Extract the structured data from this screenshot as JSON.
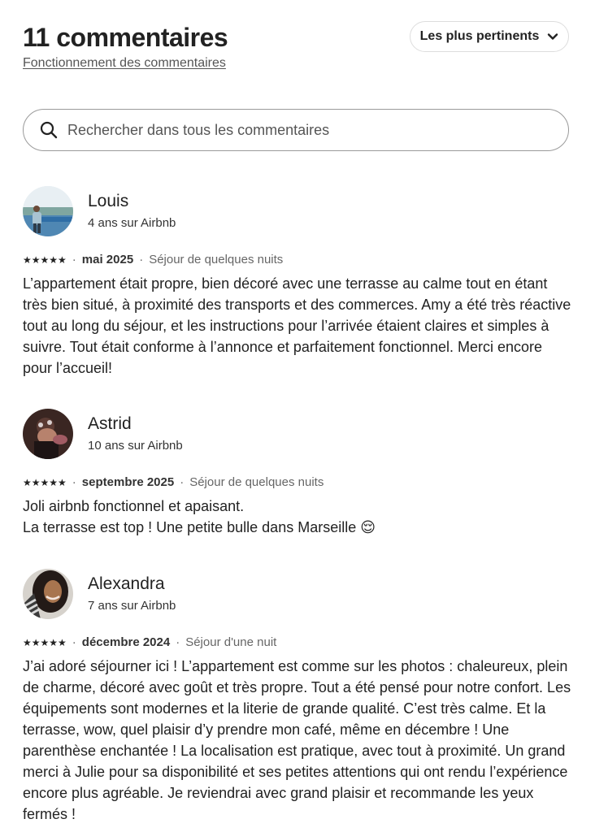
{
  "header": {
    "title": "11 commentaires",
    "how_link": "Fonctionnement des commentaires",
    "sort_label": "Les plus pertinents"
  },
  "search": {
    "placeholder": "Rechercher dans tous les commentaires"
  },
  "reviews": [
    {
      "name": "Louis",
      "tenure": "4 ans sur Airbnb",
      "stars": "★★★★★",
      "rating": 5,
      "date": "mai 2025",
      "stay": "Séjour de quelques nuits",
      "text": "L’appartement était propre, bien décoré avec une terrasse au calme tout en étant très bien situé, à proximité des transports et des commerces. Amy a été très réactive tout au long du séjour, et les instructions pour l’arrivée étaient claires et simples à suivre. Tout était conforme à l’annonce et parfaitement fonctionnel. Merci encore pour l’accueil!"
    },
    {
      "name": "Astrid",
      "tenure": "10 ans sur Airbnb",
      "stars": "★★★★★",
      "rating": 5,
      "date": "septembre 2025",
      "stay": "Séjour de quelques nuits",
      "text": "Joli airbnb fonctionnel et apaisant.\nLa terrasse est top ! Une petite bulle dans Marseille 😌"
    },
    {
      "name": "Alexandra",
      "tenure": "7 ans sur Airbnb",
      "stars": "★★★★★",
      "rating": 5,
      "date": "décembre 2024",
      "stay": "Séjour d'une nuit",
      "text": "J’ai adoré séjourner ici ! L’appartement est comme sur les photos : chaleureux, plein de charme, décoré avec goût et très propre. Tout a été pensé pour notre confort. Les équipements sont modernes et la literie de grande qualité. C’est très calme. Et la terrasse, wow, quel plaisir d’y prendre mon café, même en décembre ! Une parenthèse enchantée ! La localisation est pratique, avec tout à proximité. Un grand merci à Julie pour sa disponibilité et ses petites attentions qui ont rendu l’expérience encore plus agréable. Je reviendrai avec grand plaisir et recommande les yeux fermés !"
    }
  ],
  "icons": {
    "search": "search-icon",
    "sort": "chevron-down-icon",
    "rating": "star-icon"
  }
}
